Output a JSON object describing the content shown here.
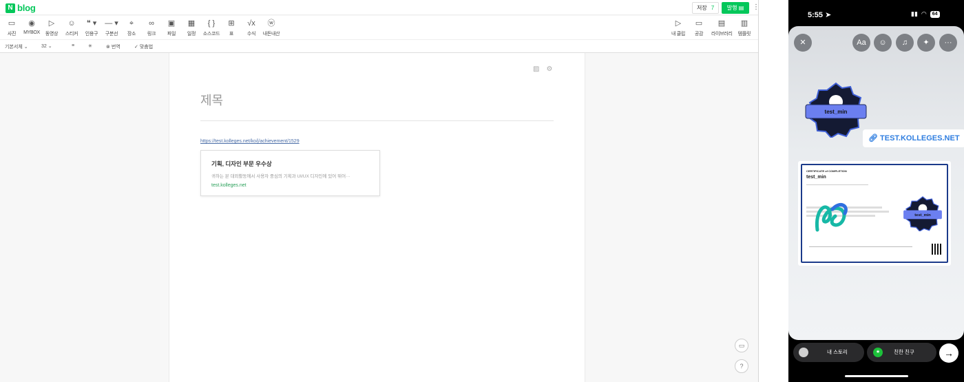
{
  "editor": {
    "logo": {
      "n": "N",
      "text": "blog"
    },
    "save": {
      "label": "저장",
      "count": "7"
    },
    "publish_label": "발행",
    "more_icon": "more-vertical-icon",
    "tools": [
      {
        "icon": "photo-icon",
        "label": "사진"
      },
      {
        "icon": "mybox-icon",
        "label": "MYBOX"
      },
      {
        "icon": "video-icon",
        "label": "동영상"
      },
      {
        "icon": "sticker-icon",
        "label": "스티커"
      },
      {
        "icon": "quote-icon",
        "label": "인용구"
      },
      {
        "icon": "divider-icon",
        "label": "구분선"
      },
      {
        "icon": "place-icon",
        "label": "장소"
      },
      {
        "icon": "link-icon",
        "label": "링크"
      },
      {
        "icon": "file-icon",
        "label": "파일"
      },
      {
        "icon": "schedule-icon",
        "label": "일정"
      },
      {
        "icon": "code-icon",
        "label": "소스코드"
      },
      {
        "icon": "table-icon",
        "label": "표"
      },
      {
        "icon": "formula-icon",
        "label": "수식"
      },
      {
        "icon": "ai-icon",
        "label": "내돈내산"
      }
    ],
    "right_tools": [
      {
        "icon": "clip-icon",
        "label": "내 클립"
      },
      {
        "icon": "empathy-icon",
        "label": "공감"
      },
      {
        "icon": "library-icon",
        "label": "라이브러리"
      },
      {
        "icon": "template-icon",
        "label": "템플릿"
      }
    ],
    "format": {
      "font": "기본서체",
      "size": "32",
      "translate": "번역",
      "spellcheck": "맞춤법"
    },
    "doc": {
      "title_placeholder": "제목",
      "link": "https://test.kolleges.net/ko/j/achievement/1529",
      "og_title": "기획, 디자인 부문 우수상",
      "og_desc": "귀하는 본 대외활동에서 사용자 중심의 기획과 UI/UX 디자인에 있어 뛰어···",
      "og_domain": "test.kolleges.net"
    },
    "help_label": "?"
  },
  "phone": {
    "time": "5:55",
    "battery": "64",
    "badge_name": "test_min",
    "link_chip": "TEST.KOLLEGES.NET",
    "certificate": {
      "tag": "CERTIFICATE of COMPLETION",
      "name": "test_min",
      "badge_name": "test_min"
    },
    "buttons": {
      "my_story": "내 스토리",
      "close_friends": "친한 친구"
    }
  }
}
